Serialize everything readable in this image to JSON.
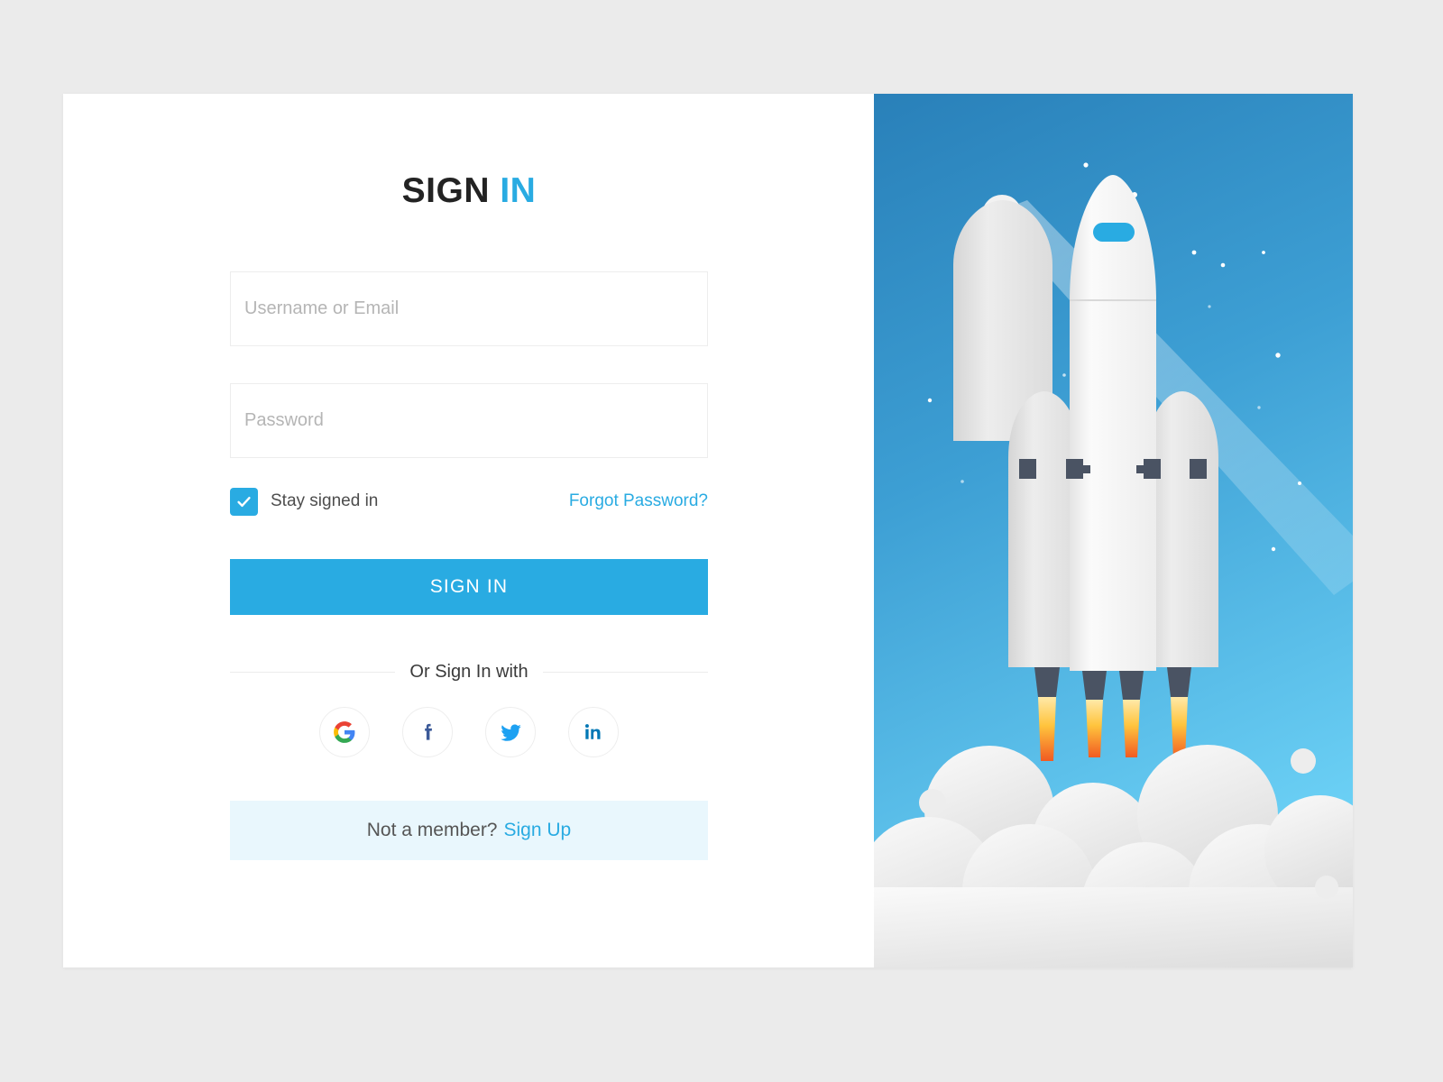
{
  "page": {
    "background_color": "#ebebeb",
    "card_background": "#ffffff",
    "accent_color": "#29abe2"
  },
  "title": {
    "primary": "SIGN",
    "accent": "IN"
  },
  "form": {
    "username": {
      "placeholder": "Username or Email",
      "value": ""
    },
    "password": {
      "placeholder": "Password",
      "value": ""
    },
    "stay_signed_in": {
      "label": "Stay signed in",
      "checked": true
    },
    "forgot_password_label": "Forgot Password?",
    "submit_label": "SIGN IN"
  },
  "divider": {
    "label": "Or Sign In with"
  },
  "social": {
    "providers": [
      {
        "name": "google",
        "label": "Google",
        "color": "#4285f4"
      },
      {
        "name": "facebook",
        "label": "Facebook",
        "color": "#3b5998"
      },
      {
        "name": "twitter",
        "label": "Twitter",
        "color": "#1da1f2"
      },
      {
        "name": "linkedin",
        "label": "LinkedIn",
        "color": "#0077b5"
      }
    ]
  },
  "signup": {
    "prompt": "Not a member?",
    "link_label": "Sign Up",
    "background_color": "#e9f7fd"
  },
  "illustration": {
    "name": "rocket-launch",
    "sky_top_color": "#2980b9",
    "sky_bottom_color": "#6bd0f5",
    "rocket_body_color": "#f2f2f2",
    "booster_color": "#e0e0e0",
    "window_color": "#29abe2",
    "nozzle_color": "#4a5363",
    "flame_top_color": "#ffd24d",
    "flame_bottom_color": "#f36f21",
    "smoke_color": "#ededed",
    "comet_color": "#f2f2f2"
  }
}
